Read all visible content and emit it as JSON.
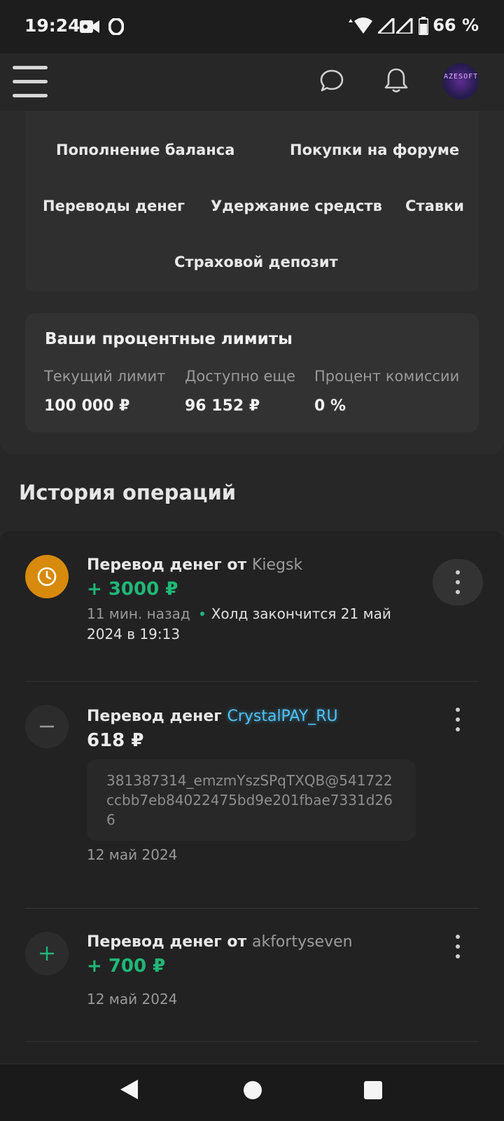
{
  "status_bar": {
    "time": "19:24",
    "battery": "66 %"
  },
  "header": {
    "menu_icon": "hamburger-menu-icon",
    "chat_icon": "chat-bubble-icon",
    "notifications_icon": "bell-icon",
    "avatar_text": "AZESOFT"
  },
  "filters": {
    "balance_topup": "Пополнение баланса",
    "forum_purchases": "Покупки на форуме",
    "money_transfers": "Переводы денег",
    "funds_hold": "Удержание средств",
    "bets": "Ставки",
    "insurance_deposit": "Страховой депозит"
  },
  "limits": {
    "title": "Ваши процентные лимиты",
    "current_label": "Текущий лимит",
    "current_value": "100 000 ₽",
    "available_label": "Доступно еще",
    "available_value": "96 152 ₽",
    "commission_label": "Процент комиссии",
    "commission_value": "0 %"
  },
  "history": {
    "title": "История операций",
    "operations": [
      {
        "title": "Перевод денег от",
        "user": "Kiegsk",
        "amount": "+ 3000 ₽",
        "time": "11 мин. назад",
        "hold": "Холд закончится 21 май 2024 в 19:13",
        "icon": "clock-icon"
      },
      {
        "title": "Перевод денег",
        "user": "CrystalPAY_RU",
        "amount": "618 ₽",
        "comment": "381387314_emzmYszSPqTXQB@541722ccbb7eb84022475bd9e201fbae7331d266",
        "date": "12 май 2024",
        "icon": "minus-icon"
      },
      {
        "title": "Перевод денег от",
        "user": "akfortyseven",
        "amount": "+ 700 ₽",
        "date": "12 май 2024",
        "icon": "plus-icon"
      }
    ]
  },
  "colors": {
    "positive": "#1fb877",
    "hold": "#d78a0b",
    "link_blue": "#4fc3f7"
  }
}
